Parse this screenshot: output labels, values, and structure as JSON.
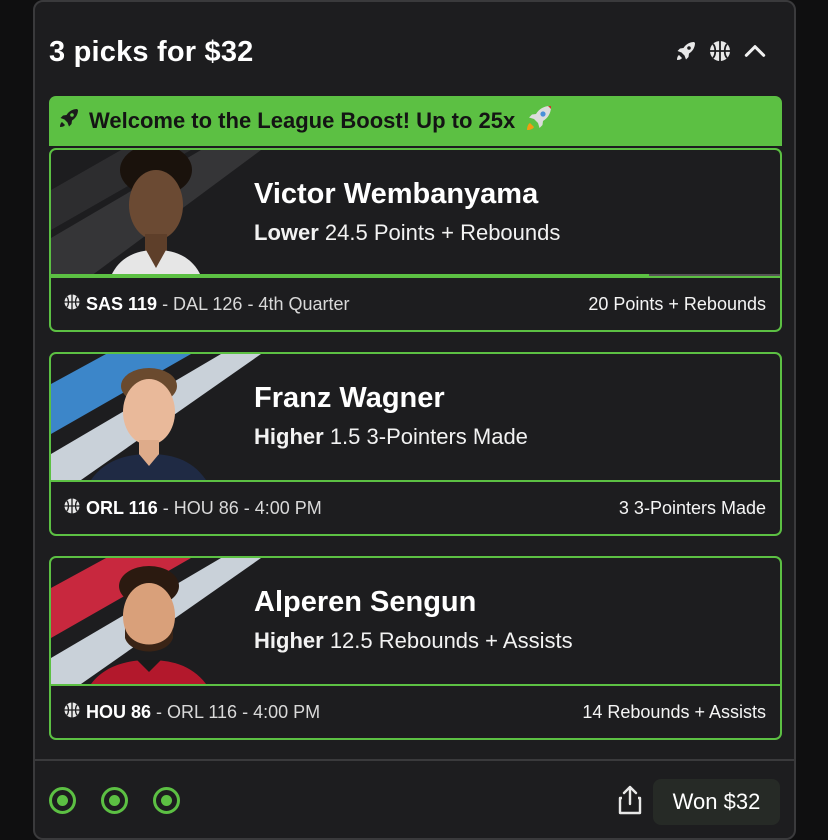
{
  "header": {
    "title": "3 picks for $32",
    "icons": [
      "rocket-icon",
      "basketball-icon",
      "chevron-up-icon"
    ]
  },
  "boost": {
    "text": "Welcome to the League Boost! Up to 25x",
    "color": "#5cc043"
  },
  "picks": [
    {
      "player": "Victor Wembanyama",
      "direction": "Lower",
      "line": "24.5 Points + Rebounds",
      "game_team": "SAS 119",
      "game_rest": "- DAL 126 - 4th Quarter",
      "stat": "20 Points + Rebounds",
      "progress": 0.82,
      "stripe_colors": [
        "#2d2d2f",
        "#3a3a3c"
      ]
    },
    {
      "player": "Franz Wagner",
      "direction": "Higher",
      "line": "1.5 3-Pointers Made",
      "game_team": "ORL 116",
      "game_rest": "- HOU 86 - 4:00 PM",
      "stat": "3 3-Pointers Made",
      "stripe_colors": [
        "#3c86c9",
        "#c9d1d9"
      ]
    },
    {
      "player": "Alperen Sengun",
      "direction": "Higher",
      "line": "12.5 Rebounds + Assists",
      "game_team": "HOU 86",
      "game_rest": "- ORL 116 - 4:00 PM",
      "stat": "14 Rebounds + Assists",
      "stripe_colors": [
        "#c8283e",
        "#c9d1d9"
      ]
    }
  ],
  "footer": {
    "won_label": "Won $32",
    "status_dots": 3
  }
}
